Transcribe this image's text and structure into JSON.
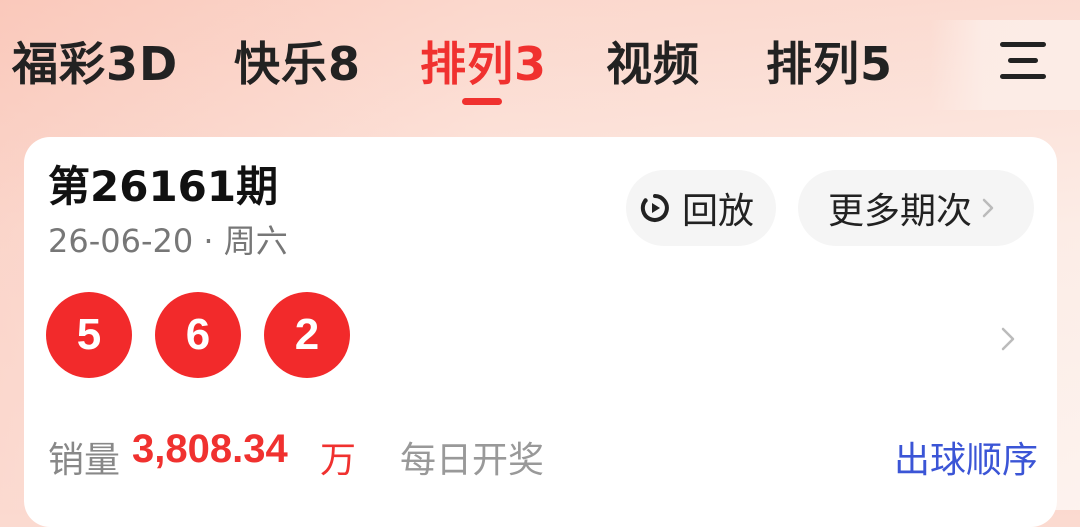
{
  "tabs": [
    {
      "label": "福彩3D",
      "active": false
    },
    {
      "label": "快乐8",
      "active": false
    },
    {
      "label": "排列3",
      "active": true
    },
    {
      "label": "视频",
      "active": false
    },
    {
      "label": "排列5",
      "active": false
    }
  ],
  "colors": {
    "accent": "#f0312f",
    "ball": "#f22a2b",
    "link": "#3b55d6",
    "muted": "#888888"
  },
  "icons": {
    "menu": "hamburger-menu-icon",
    "replay": "replay-clock-icon",
    "chevron": "chevron-right-icon"
  },
  "draw": {
    "period": "第26161期",
    "date": "26-06-20 · 周六",
    "replay_label": "回放",
    "more_periods_label": "更多期次",
    "numbers": [
      "5",
      "6",
      "2"
    ],
    "sales_label": "销量",
    "sales_value": "3,808.34",
    "sales_unit": "万",
    "schedule": "每日开奖",
    "ball_order_link": "出球顺序"
  }
}
